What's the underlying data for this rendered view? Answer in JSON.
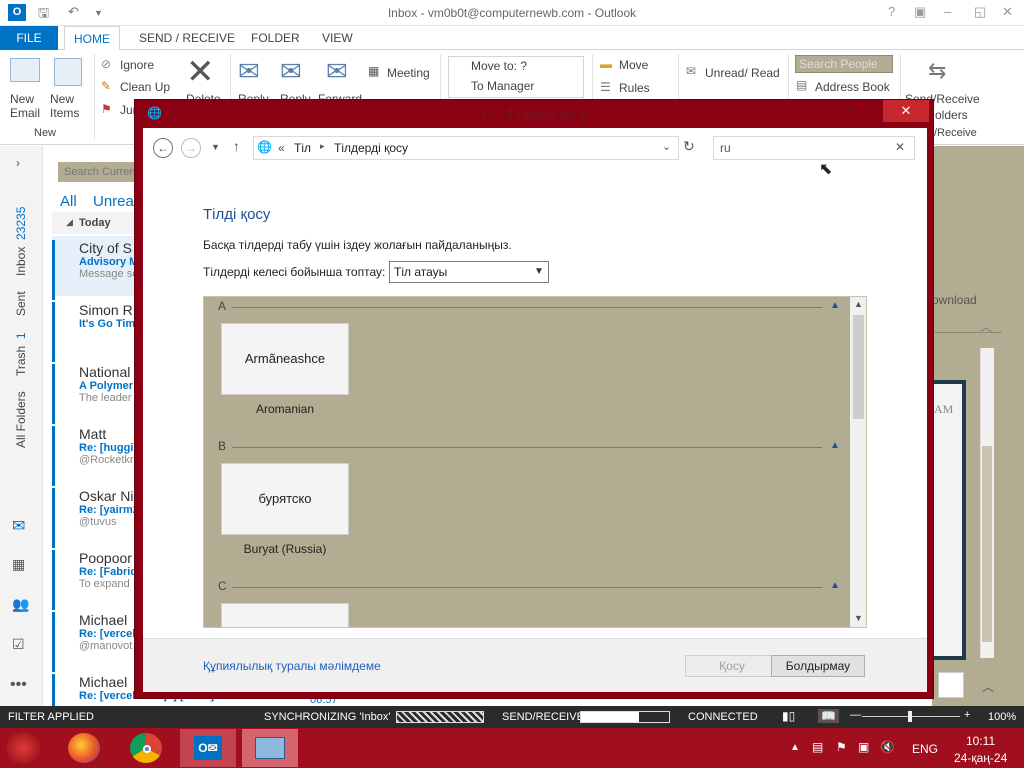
{
  "outlook": {
    "title": "Inbox - vm0b0t@computernewb.com - Outlook",
    "tabs": [
      "FILE",
      "HOME",
      "SEND / RECEIVE",
      "FOLDER",
      "VIEW"
    ],
    "ribbon": {
      "new_email": "New Email",
      "new_items": "New Items",
      "ignore": "Ignore",
      "clean_up": "Clean Up",
      "junk": "Jun",
      "delete": "Delete",
      "reply": "Reply",
      "reply_all": "Reply",
      "forward": "Forward",
      "meeting": "Meeting",
      "move_to": "Move to: ?",
      "to_manager": "To Manager",
      "move": "Move",
      "rules": "Rules",
      "unread_read": "Unread/ Read",
      "search_people": "Search People",
      "address_book": "Address Book",
      "send_receive": "Send/Receive",
      "all_folders": "olders",
      "group_new": "New",
      "group_send_receive": "/Receive"
    },
    "nav": {
      "inbox": "Inbox",
      "inbox_count": "23235",
      "sent": "Sent",
      "trash": "Trash",
      "trash_count": "1",
      "all_folders": "All Folders"
    },
    "filter": {
      "search_placeholder": "Search Curren",
      "all": "All",
      "unread": "Unread"
    },
    "today": "Today",
    "messages": [
      {
        "sender": "City of S",
        "subject": "Advisory M",
        "preview": "Message se"
      },
      {
        "sender": "Simon R",
        "subject": "It's Go Tim",
        "preview": ""
      },
      {
        "sender": "National",
        "subject": "A Polymer",
        "preview": "The leader"
      },
      {
        "sender": "Matt",
        "subject": "Re: [huggi",
        "preview": "@Rocketkr"
      },
      {
        "sender": "Oskar Ni",
        "subject": "Re: [yairm2",
        "preview": "@tuvus"
      },
      {
        "sender": "Poopoor",
        "subject": "Re: [Fabric",
        "preview": "To expand"
      },
      {
        "sender": "Michael",
        "subject": "Re: [vercel/",
        "preview": "@manovot"
      },
      {
        "sender": "Michael",
        "subject": "Re: [vercel/next.js] [Docs] Adds e...",
        "preview": "",
        "time": "06:57"
      }
    ],
    "reading_pane": {
      "download": "ownload",
      "am": "AM"
    }
  },
  "status": {
    "filter": "FILTER APPLIED",
    "sync": "SYNCHRONIZING  'Inbox'",
    "send_receive": "SEND/RECEIVE",
    "connected": "CONNECTED",
    "zoom": "100%"
  },
  "taskbar": {
    "lang": "ENG",
    "time": "10:11",
    "date": "24-қаң-24"
  },
  "dialog": {
    "title": "ru - Тілдерді қосу",
    "breadcrumb": [
      "«",
      "Тіл",
      "Тілдерді қосу"
    ],
    "search_value": "ru",
    "heading": "Тілді қосу",
    "description": "Басқа тілдерді табу үшін іздеу жолағын пайдаланыңыз.",
    "group_label": "Тілдерді келесі бойынша топтау:",
    "group_value": "Тіл атауы",
    "sections": [
      {
        "letter": "A",
        "tile": "Armãneashce",
        "caption": "Aromanian"
      },
      {
        "letter": "B",
        "tile": "бурятско",
        "caption": "Buryat (Russia)"
      },
      {
        "letter": "C",
        "tile": "",
        "caption": ""
      }
    ],
    "privacy_link": "Құпиялылық туралы мәлімдеме",
    "add_button": "Қосу",
    "cancel_button": "Болдырмау"
  }
}
